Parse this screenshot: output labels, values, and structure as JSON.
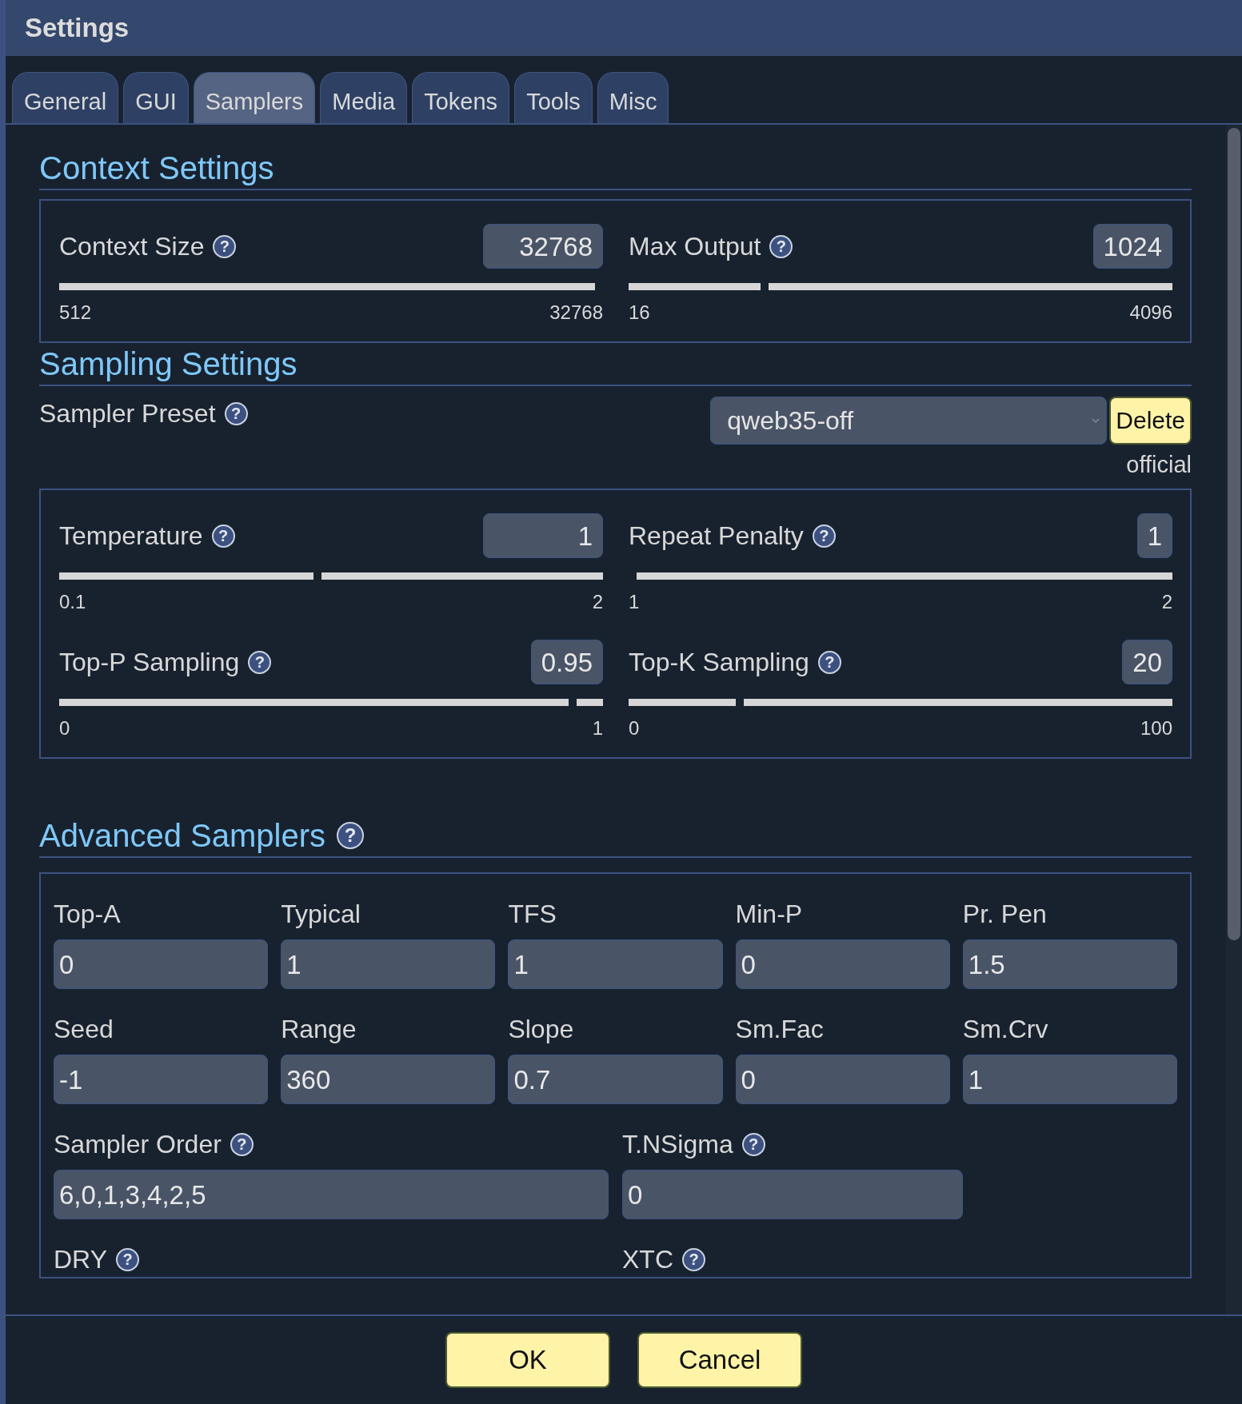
{
  "window": {
    "title": "Settings"
  },
  "tabs": [
    {
      "label": "General",
      "selected": false
    },
    {
      "label": "GUI",
      "selected": false
    },
    {
      "label": "Samplers",
      "selected": true
    },
    {
      "label": "Media",
      "selected": false
    },
    {
      "label": "Tokens",
      "selected": false
    },
    {
      "label": "Tools",
      "selected": false
    },
    {
      "label": "Misc",
      "selected": false
    }
  ],
  "sections": [
    {
      "kind": "sliders",
      "title": "Context Settings",
      "sliders": [
        {
          "label": "Context Size",
          "help": "?",
          "value": "32768",
          "level": 1,
          "min": "512",
          "max": "32768"
        },
        {
          "label": "Max Output",
          "help": "?",
          "value": "1024",
          "level": 0.247,
          "min": "16",
          "max": "4096"
        }
      ]
    },
    {
      "kind": "preset",
      "title": "Sampling Settings",
      "preset": {
        "label": "Sampler Preset",
        "help": "?",
        "value": "qweb35-off",
        "button": "Delete",
        "note": "official"
      },
      "sliders": [
        {
          "label": "Temperature",
          "help": "?",
          "value": "1",
          "level": 0.474,
          "min": "0.1",
          "max": "2"
        },
        {
          "label": "Repeat Penalty",
          "help": "?",
          "value": "1",
          "level": 0,
          "min": "1",
          "max": "2"
        },
        {
          "label": "Top-P Sampling",
          "help": "?",
          "value": "0.95",
          "level": 0.95,
          "min": "0",
          "max": "1"
        },
        {
          "label": "Top-K Sampling",
          "help": "?",
          "value": "20",
          "level": 0.2,
          "min": "0",
          "max": "100"
        }
      ]
    },
    {
      "kind": "fields",
      "title": "Advanced Samplers",
      "help": "?",
      "fields": [
        {
          "kind": "small",
          "label": "Top-A",
          "value": "0"
        },
        {
          "kind": "small",
          "label": "Typical",
          "value": "1"
        },
        {
          "kind": "small",
          "label": "TFS",
          "value": "1"
        },
        {
          "kind": "small",
          "label": "Min-P",
          "value": "0"
        },
        {
          "kind": "small",
          "label": "Pr. Pen",
          "value": "1.5"
        },
        {
          "kind": "small",
          "label": "Seed",
          "value": "-1"
        },
        {
          "kind": "small",
          "label": "Range",
          "value": "360"
        },
        {
          "kind": "small",
          "label": "Slope",
          "value": "0.7"
        },
        {
          "kind": "small",
          "label": "Sm.Fac",
          "value": "0"
        },
        {
          "kind": "small",
          "label": "Sm.Crv",
          "value": "1"
        },
        {
          "kind": "wide",
          "label": "Sampler Order",
          "help": "?",
          "value": "6,0,1,3,4,2,5"
        },
        {
          "kind": "wide",
          "label": "T.NSigma",
          "help": "?",
          "value": "0"
        },
        {
          "kind": "wide",
          "label": "DRY",
          "help": "?"
        },
        {
          "kind": "wide",
          "label": "XTC",
          "help": "?"
        }
      ]
    }
  ],
  "buttons": [
    "OK",
    "Cancel"
  ]
}
